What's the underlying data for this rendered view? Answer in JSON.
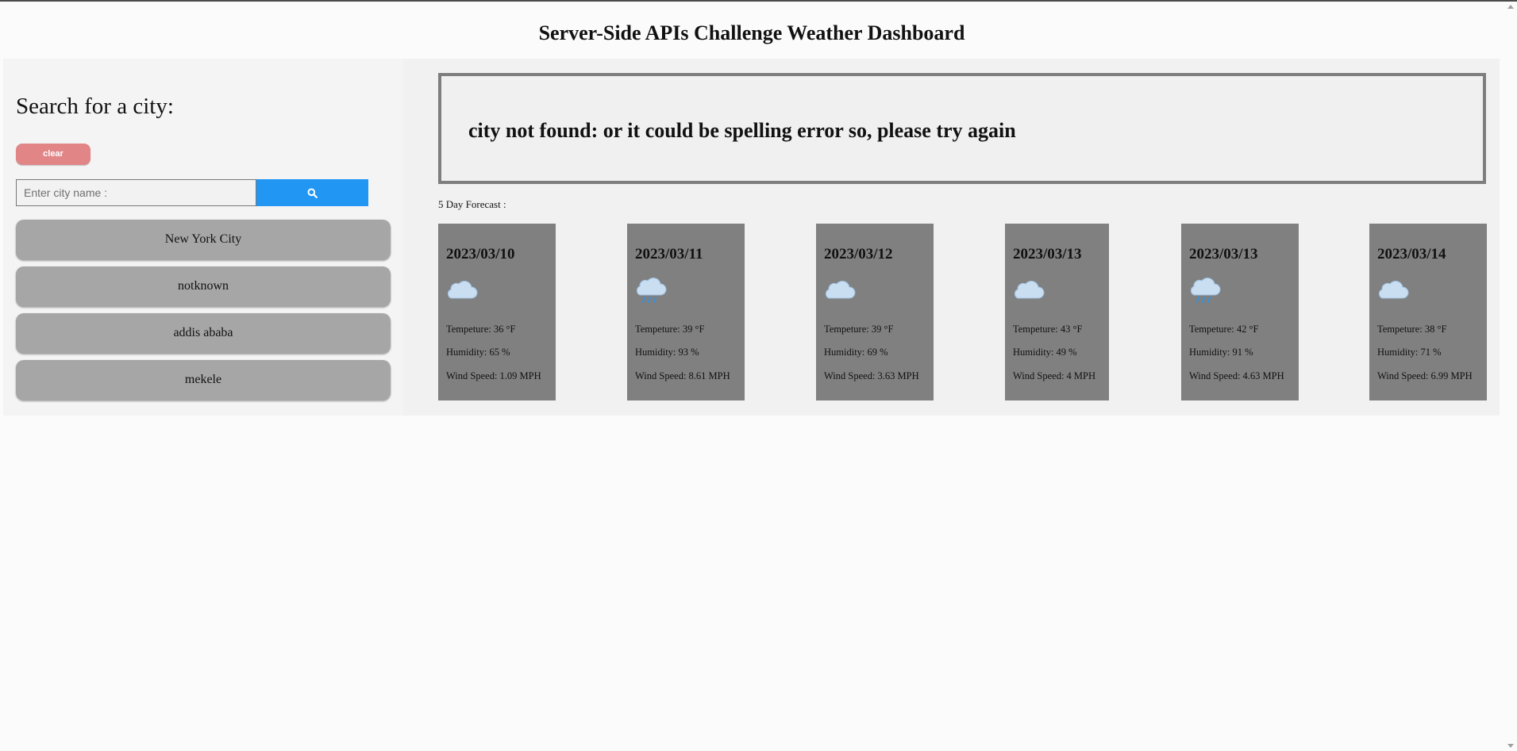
{
  "header": {
    "title": "Server-Side APIs Challenge Weather Dashboard"
  },
  "sidebar": {
    "title": "Search for a city:",
    "clear_label": "clear",
    "search_placeholder": "Enter city name :",
    "search_value": "",
    "history": [
      "New York City",
      "notknown",
      "addis ababa",
      "mekele"
    ]
  },
  "current": {
    "message": "city not found: or it could be spelling error so, please try again"
  },
  "forecast": {
    "label": "5 Day Forecast :",
    "days": [
      {
        "date": "2023/03/10",
        "icon": "cloud-icon",
        "temp": "Tempeture: 36 °F",
        "humidity": "Humidity: 65 %",
        "wind": "Wind Speed: 1.09 MPH"
      },
      {
        "date": "2023/03/11",
        "icon": "rain-cloud-icon",
        "temp": "Tempeture: 39 °F",
        "humidity": "Humidity: 93 %",
        "wind": "Wind Speed: 8.61 MPH"
      },
      {
        "date": "2023/03/12",
        "icon": "cloud-icon",
        "temp": "Tempeture: 39 °F",
        "humidity": "Humidity: 69 %",
        "wind": "Wind Speed: 3.63 MPH"
      },
      {
        "date": "2023/03/13",
        "icon": "cloud-icon",
        "temp": "Tempeture: 43 °F",
        "humidity": "Humidity: 49 %",
        "wind": "Wind Speed: 4 MPH"
      },
      {
        "date": "2023/03/13",
        "icon": "rain-cloud-icon",
        "temp": "Tempeture: 42 °F",
        "humidity": "Humidity: 91 %",
        "wind": "Wind Speed: 4.63 MPH"
      },
      {
        "date": "2023/03/14",
        "icon": "cloud-icon",
        "temp": "Tempeture: 38 °F",
        "humidity": "Humidity: 71 %",
        "wind": "Wind Speed: 6.99 MPH"
      }
    ]
  },
  "colors": {
    "clear_button": "#e28587",
    "search_button": "#2196f3",
    "history_button": "#a6a6a6",
    "forecast_card": "#808080"
  }
}
